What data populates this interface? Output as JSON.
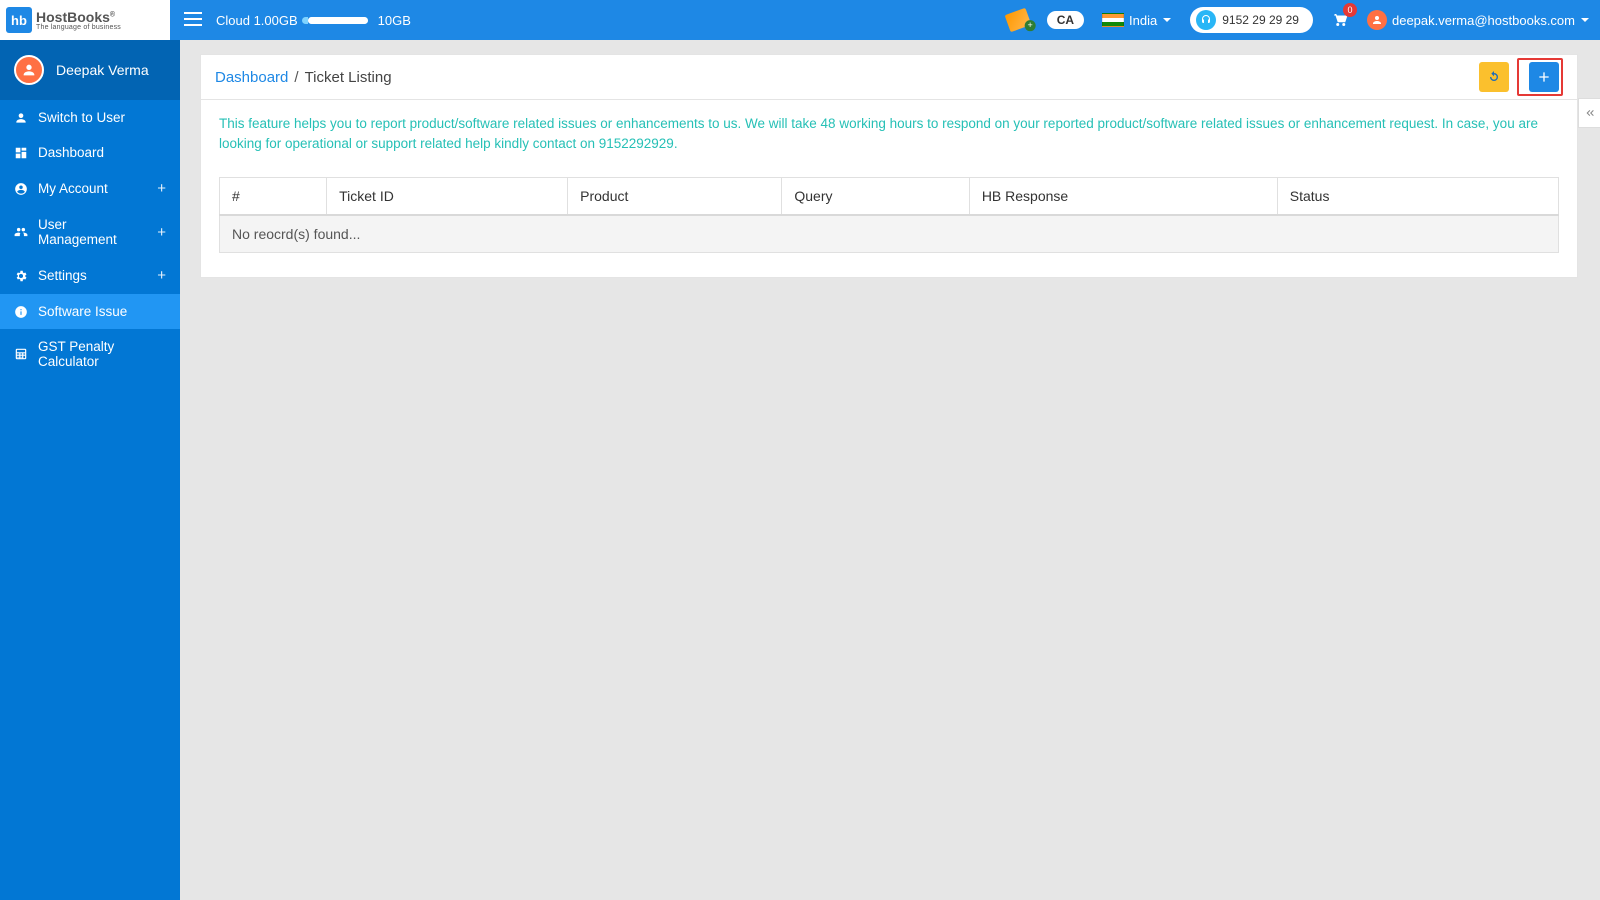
{
  "brand": {
    "abbr": "hb",
    "name": "HostBooks",
    "tagline": "The language of business",
    "reg": "®"
  },
  "topbar": {
    "cloud_used": "Cloud 1.00GB",
    "cloud_total": "10GB",
    "ca_label": "CA",
    "country": "India",
    "phone": "9152 29 29 29",
    "cart_count": "0",
    "email": "deepak.verma@hostbooks.com"
  },
  "sidebar": {
    "user": "Deepak Verma",
    "items": [
      {
        "label": "Switch to User",
        "icon": "user",
        "expandable": false,
        "active": false
      },
      {
        "label": "Dashboard",
        "icon": "dash",
        "expandable": false,
        "active": false
      },
      {
        "label": "My Account",
        "icon": "account",
        "expandable": true,
        "active": false
      },
      {
        "label": "User Management",
        "icon": "users",
        "expandable": true,
        "active": false
      },
      {
        "label": "Settings",
        "icon": "gear",
        "expandable": true,
        "active": false
      },
      {
        "label": "Software Issue",
        "icon": "info",
        "expandable": false,
        "active": true
      },
      {
        "label": "GST Penalty Calculator",
        "icon": "calc",
        "expandable": false,
        "active": false
      }
    ]
  },
  "breadcrumb": {
    "root": "Dashboard",
    "sep": "/",
    "current": "Ticket Listing"
  },
  "notice": "This feature helps you to report product/software related issues or enhancements to us. We will take 48 working hours to respond on your reported product/software related issues or enhancement request. In case, you are looking for operational or support related help kindly contact on 9152292929.",
  "table": {
    "columns": [
      "#",
      "Ticket ID",
      "Product",
      "Query",
      "HB Response",
      "Status"
    ],
    "empty": "No reocrd(s) found..."
  }
}
